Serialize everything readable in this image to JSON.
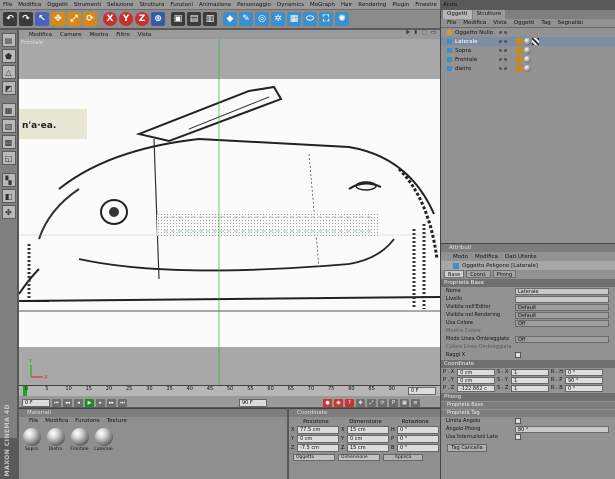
{
  "menubar": [
    "File",
    "Modifica",
    "Oggetti",
    "Strumenti",
    "Selezione",
    "Struttura",
    "Funzioni",
    "Animazione",
    "Personaggio",
    "Dynamics",
    "MoGraph",
    "Hair",
    "Rendering",
    "Plugin",
    "Finestre",
    "Aiuto"
  ],
  "viewport": {
    "menu": [
      "Modifica",
      "Camere",
      "Mostra",
      "Filtro",
      "Vista"
    ],
    "label": "Frontale",
    "nav": "✥ ⬍ ⬚ ▭"
  },
  "timeline": {
    "ticks": [
      "0",
      "5",
      "10",
      "15",
      "20",
      "25",
      "30",
      "35",
      "40",
      "45",
      "50",
      "55",
      "60",
      "65",
      "70",
      "75",
      "80",
      "85",
      "90"
    ],
    "frame_box": "0 F",
    "start": "0 F",
    "end": "90 F"
  },
  "materials": {
    "title": "Materiali",
    "menu": [
      "File",
      "Modifica",
      "Funzione",
      "Texture"
    ],
    "items": [
      "Sopra",
      "Dietro",
      "Frontale",
      "Laterale"
    ]
  },
  "maxon_logo": "MAXON CINEMA 4D",
  "coordinates": {
    "title": "Coordinate",
    "headers": [
      "Posizione",
      "Dimensione",
      "Rotazione"
    ],
    "rows": [
      {
        "a": "X",
        "pos": "77.5 cm",
        "b": "X",
        "dim": "15 cm",
        "c": "H",
        "rot": "0 °"
      },
      {
        "a": "Y",
        "pos": "0 cm",
        "b": "Y",
        "dim": "0 cm",
        "c": "P",
        "rot": "0 °"
      },
      {
        "a": "Z",
        "pos": "-7.5 cm",
        "b": "Z",
        "dim": "15 cm",
        "c": "B",
        "rot": "0 °"
      }
    ],
    "mode1": "Oggetto",
    "mode2": "Dimensione",
    "apply": "Applica"
  },
  "objects": {
    "tabs": [
      "Oggetti",
      "Strutture"
    ],
    "menu": [
      "File",
      "Modifica",
      "Vista",
      "Oggetti",
      "Tag",
      "Segnalibi"
    ],
    "items": [
      {
        "name": "Oggetto Nullo",
        "selected": false
      },
      {
        "name": "Laterale",
        "selected": true
      },
      {
        "name": "Sopra",
        "selected": false
      },
      {
        "name": "Frontale",
        "selected": false
      },
      {
        "name": "dietro",
        "selected": false
      }
    ]
  },
  "attributes": {
    "title": "Attributi",
    "menu": [
      "Modo",
      "Modifica",
      "Dati Utente"
    ],
    "object_title": "Oggetto Poligono [Laterale]",
    "tabs": [
      "Base",
      "Coord.",
      "Phong"
    ],
    "section_base": "Proprietà Base",
    "props": [
      {
        "label": "Nome",
        "value": "Laterale",
        "kind": "text"
      },
      {
        "label": "Livello",
        "value": "",
        "kind": "text"
      },
      {
        "label": "Visibile nell'Editor",
        "value": "Default",
        "kind": "drop"
      },
      {
        "label": "Visibile nel Rendering",
        "value": "Default",
        "kind": "drop"
      },
      {
        "label": "Usa Colore",
        "value": "Off",
        "kind": "drop"
      },
      {
        "label": "Mostra Colore",
        "value": "",
        "kind": "dim"
      },
      {
        "label": "Modo Linea Ombreggiata",
        "value": "Off",
        "kind": "drop"
      },
      {
        "label": "Colore Linea Ombreggiata",
        "value": "",
        "kind": "dim"
      },
      {
        "label": "Raggi X",
        "value": "",
        "kind": "check"
      }
    ],
    "section_coord": "Coordinate",
    "coords": [
      {
        "l1": "P . X",
        "v1": "0 cm",
        "l2": "S . X",
        "v2": "1",
        "l3": "R . H",
        "v3": "0 °"
      },
      {
        "l1": "P . Y",
        "v1": "0 cm",
        "l2": "S . Y",
        "v2": "1",
        "l3": "R . P",
        "v3": "90 °"
      },
      {
        "l1": "P . Z",
        "v1": "-122.862 c",
        "l2": "S . Z",
        "v2": "1",
        "l3": "R . B",
        "v3": "0 °"
      }
    ],
    "section_phong": "Phong",
    "phong_sub1": "Proprietà Base",
    "phong_sub2": "Proprietà Tag",
    "phong_props": [
      {
        "label": "Limita Angolo",
        "value": "",
        "kind": "check"
      },
      {
        "label": "Angolo Phong",
        "value": "80 °",
        "kind": "text"
      },
      {
        "label": "Usa Interruzioni Lato",
        "value": "",
        "kind": "check"
      }
    ],
    "delete_tag": "Tag Cancella"
  }
}
